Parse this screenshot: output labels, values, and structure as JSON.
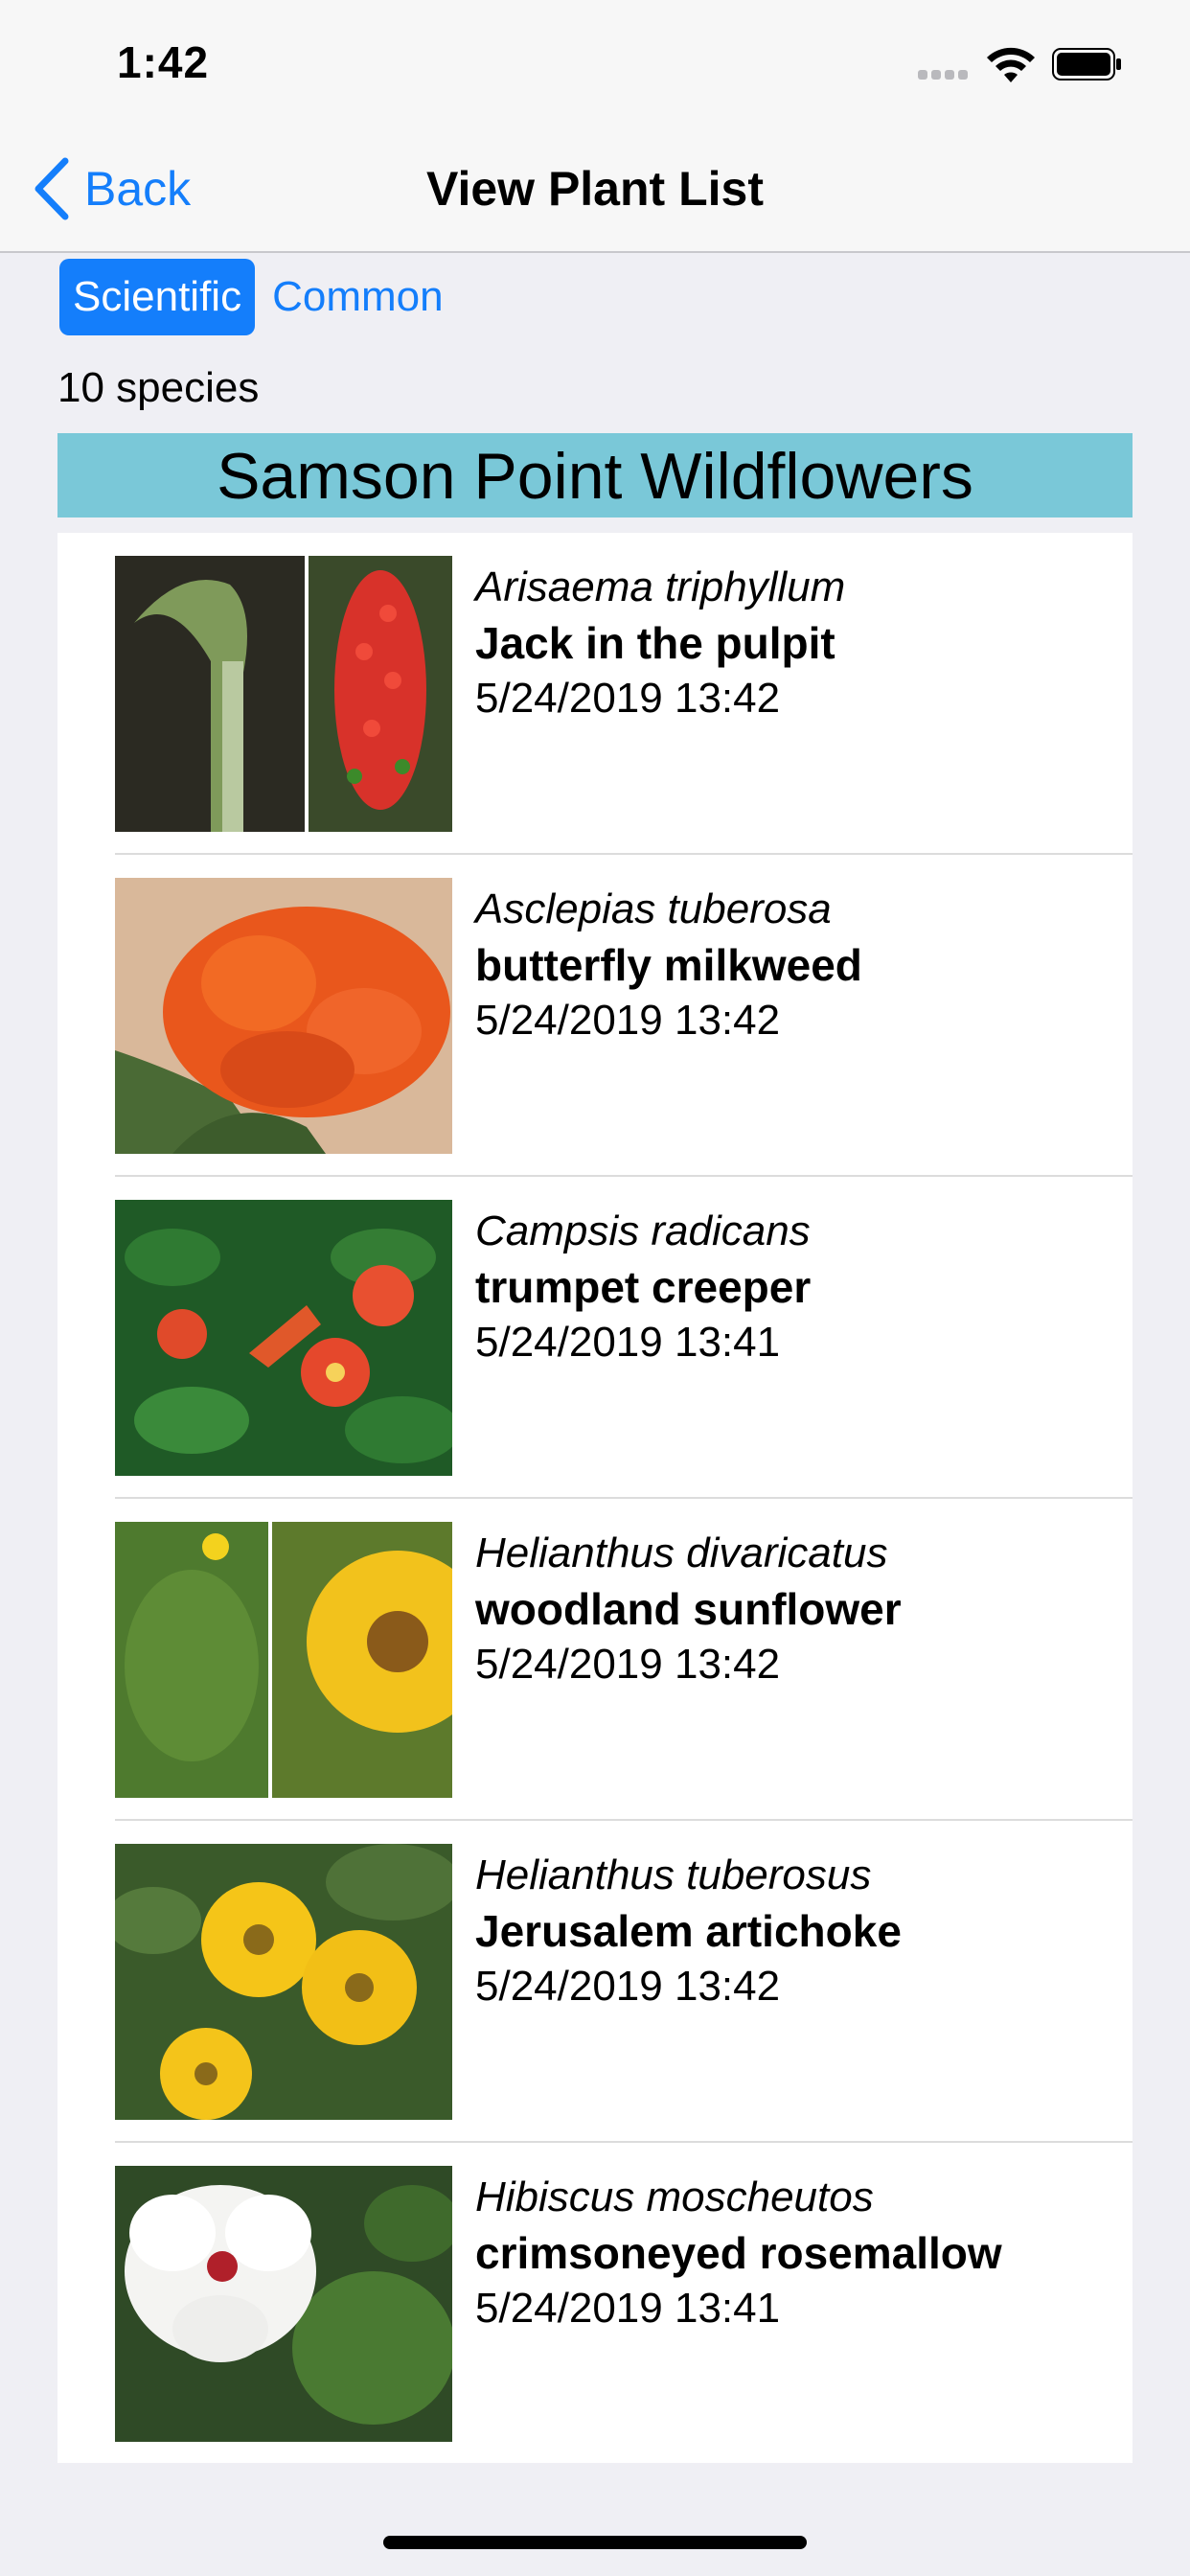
{
  "status_bar": {
    "time": "1:42"
  },
  "nav": {
    "back_label": "Back",
    "title": "View Plant List"
  },
  "segments": [
    {
      "label": "Scientific",
      "selected": true
    },
    {
      "label": "Common",
      "selected": false
    }
  ],
  "species_count": "10 species",
  "section": {
    "title": "Samson Point Wildflowers",
    "header_color": "#7ac8d8"
  },
  "accent_color": "#147efb",
  "plants": [
    {
      "scientific": "Arisaema triphyllum",
      "common": "Jack in the pulpit",
      "date": "5/24/2019 13:42",
      "thumbnail": "jack-in-the-pulpit-photo"
    },
    {
      "scientific": "Asclepias tuberosa",
      "common": "butterfly milkweed",
      "date": "5/24/2019 13:42",
      "thumbnail": "butterfly-milkweed-photo"
    },
    {
      "scientific": "Campsis radicans",
      "common": "trumpet creeper",
      "date": "5/24/2019 13:41",
      "thumbnail": "trumpet-creeper-photo"
    },
    {
      "scientific": "Helianthus divaricatus",
      "common": "woodland sunflower",
      "date": "5/24/2019 13:42",
      "thumbnail": "woodland-sunflower-photo"
    },
    {
      "scientific": "Helianthus tuberosus",
      "common": "Jerusalem artichoke",
      "date": "5/24/2019 13:42",
      "thumbnail": "jerusalem-artichoke-photo"
    },
    {
      "scientific": "Hibiscus moscheutos",
      "common": "crimsoneyed rosemallow",
      "date": "5/24/2019 13:41",
      "thumbnail": "rosemallow-photo"
    }
  ]
}
